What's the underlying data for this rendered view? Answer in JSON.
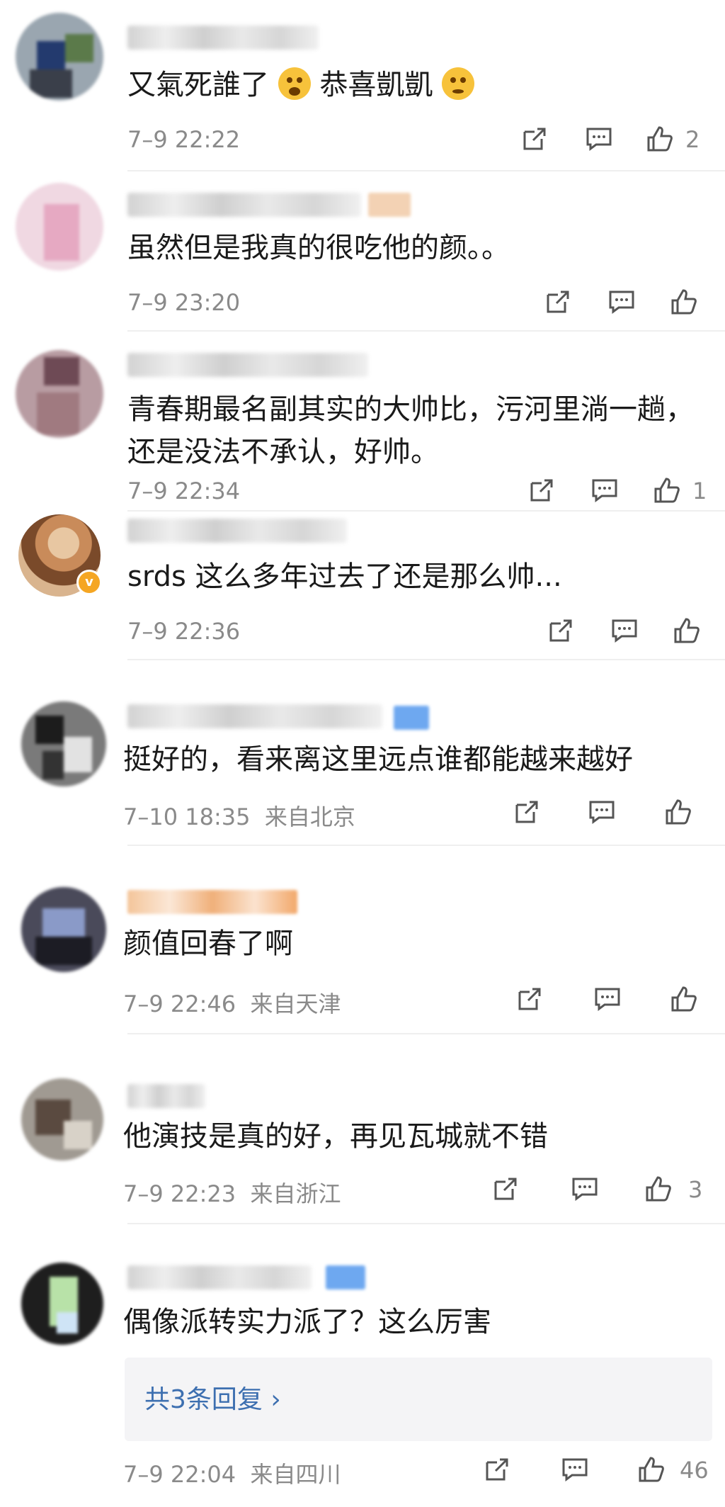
{
  "comments": [
    {
      "text": "又氣死誰了",
      "text2": "恭喜凱凱",
      "time": "7–9 22:22",
      "location": "",
      "likes": "2"
    },
    {
      "text": "虽然但是我真的很吃他的颜。。",
      "time": "7–9 23:20",
      "location": "",
      "likes": ""
    },
    {
      "text": "青春期最名副其实的大帅比，污河里淌一趟，",
      "text_line2": "还是没法不承认，好帅。",
      "time": "7–9 22:34",
      "location": "",
      "likes": "1"
    },
    {
      "text": "srds 这么多年过去了还是那么帅...",
      "time": "7–9 22:36",
      "location": "",
      "likes": ""
    },
    {
      "text": "挺好的，看来离这里远点谁都能越来越好",
      "time": "7–10 18:35",
      "location": "来自北京",
      "likes": ""
    },
    {
      "text": "颜值回春了啊",
      "time": "7–9 22:46",
      "location": "来自天津",
      "likes": ""
    },
    {
      "text": "他演技是真的好，再见瓦城就不错",
      "time": "7–9 22:23",
      "location": "来自浙江",
      "likes": "3"
    },
    {
      "text": "偶像派转实力派了？这么厉害",
      "time": "7–9 22:04",
      "location": "来自四川",
      "likes": "46",
      "replies": "共3条回复 ›"
    }
  ],
  "colors": {
    "accent_link": "#3d6fb0",
    "meta_gray": "#8a8a8a",
    "verified_badge": "#f5a623"
  },
  "icons": [
    "share-icon",
    "comment-icon",
    "like-icon",
    "verified-badge-icon",
    "emoji-icon"
  ]
}
